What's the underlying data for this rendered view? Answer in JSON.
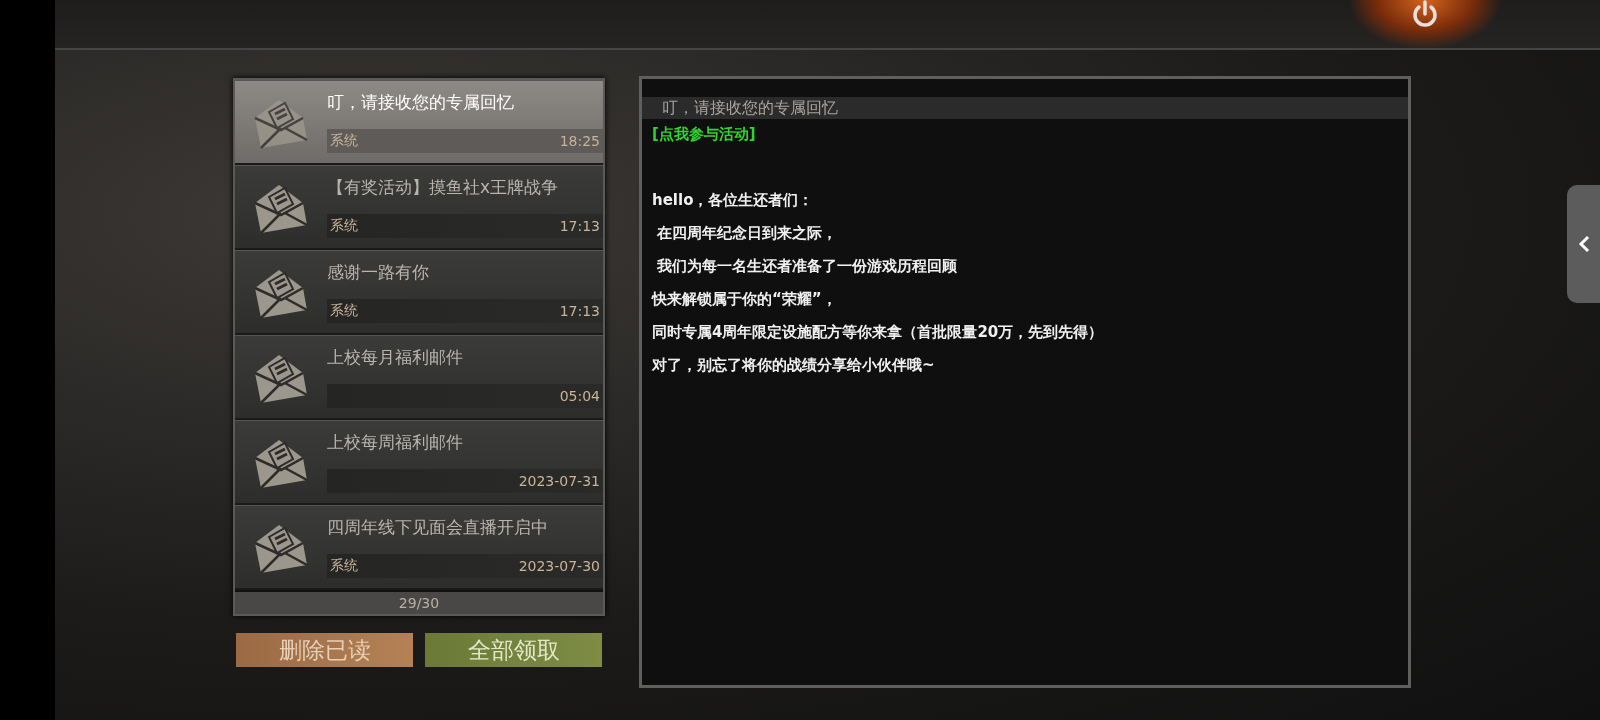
{
  "mail_list": {
    "items": [
      {
        "title": "叮，请接收您的专属回忆",
        "sender": "系统",
        "time": "18:25",
        "selected": true
      },
      {
        "title": "【有奖活动】摸鱼社x王牌战争",
        "sender": "系统",
        "time": "17:13",
        "selected": false
      },
      {
        "title": "感谢一路有你",
        "sender": "系统",
        "time": "17:13",
        "selected": false
      },
      {
        "title": "上校每月福利邮件",
        "time": "05:04",
        "selected": false
      },
      {
        "title": "上校每周福利邮件",
        "time": "2023-07-31",
        "selected": false
      },
      {
        "title": "四周年线下见面会直播开启中",
        "sender": "系统",
        "time": "2023-07-30",
        "selected": false
      }
    ],
    "count": "29/30"
  },
  "buttons": [
    {
      "label": "删除已读",
      "kind": "delete"
    },
    {
      "label": "全部领取",
      "kind": "claim"
    }
  ],
  "message": {
    "title": "叮，请接收您的专属回忆",
    "lines": [
      {
        "kind": "link",
        "text": "[点我参与活动]"
      },
      {
        "kind": "text",
        "text": "hello，各位生还者们："
      },
      {
        "kind": "text",
        "text": " 在四周年纪念日到来之际，"
      },
      {
        "kind": "text",
        "text": " 我们为每一名生还者准备了一份游戏历程回顾"
      },
      {
        "kind": "text",
        "text": "快来解锁属于你的“荣耀”，"
      },
      {
        "kind": "text",
        "text": "同时专属4周年限定设施配方等你来拿（首批限量20万，先到先得）"
      },
      {
        "kind": "text",
        "text": "对了，别忘了将你的战绩分享给小伙伴哦~"
      }
    ]
  }
}
